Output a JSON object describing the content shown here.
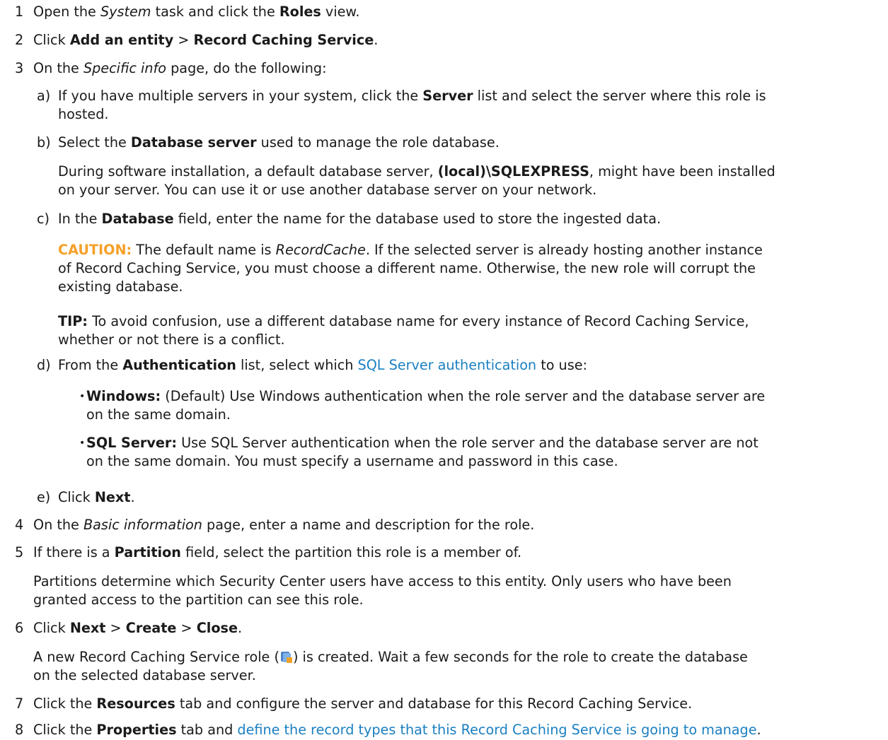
{
  "steps": [
    {
      "num": "1",
      "t1": "Open the ",
      "i1": "System",
      "t2": " task and click the ",
      "b1": "Roles",
      "t3": " view."
    },
    {
      "num": "2",
      "t1": "Click ",
      "b1": "Add an entity",
      "t2": " > ",
      "b2": "Record Caching Service",
      "t3": "."
    },
    {
      "num": "3",
      "t1": "On the ",
      "i1": "Specific info",
      "t2": " page, do the following:"
    },
    {
      "num": "4",
      "t1": "On the ",
      "i1": "Basic information",
      "t2": " page, enter a name and description for the role."
    },
    {
      "num": "5",
      "t1": "If there is a ",
      "b1": "Partition",
      "t2": " field, select the partition this role is a member of.",
      "p1": "Partitions determine which Security Center users have access to this entity. Only users who have been",
      "p2": "granted access to the partition can see this role."
    },
    {
      "num": "6",
      "t1": "Click ",
      "b1": "Next",
      "t2": " > ",
      "b2": "Create",
      "t3": " > ",
      "b3": "Close",
      "t4": ".",
      "p1a": "A new Record Caching Service role (",
      "p1b": ") is created. Wait a few seconds for the role to create the database",
      "p2": "on the selected database server."
    },
    {
      "num": "7",
      "t1": "Click the ",
      "b1": "Resources",
      "t2": " tab and configure the server and database for this Record Caching Service."
    },
    {
      "num": "8",
      "t1": "Click the ",
      "b1": "Properties",
      "t2": " tab and ",
      "link": "define the record types that this Record Caching Service is going to manage",
      "t3": "."
    }
  ],
  "substeps": {
    "a": {
      "letter": "a)",
      "t1": "If you have multiple servers in your system, click the ",
      "b1": "Server",
      "t2": " list and select the server where this role is",
      "l2": "hosted."
    },
    "b": {
      "letter": "b)",
      "t1": "Select the ",
      "b1": "Database server",
      "t2": " used to manage the role database.",
      "p1a": "During software installation, a default database server, ",
      "p1b": "(local)\\SQLEXPRESS",
      "p1c": ", might have been installed",
      "p2": "on your server. You can use it or use another database server on your network."
    },
    "c": {
      "letter": "c)",
      "t1": "In the ",
      "b1": "Database",
      "t2": " field, enter the name for the database used to store the ingested data.",
      "caution_label": "CAUTION:",
      "c1a": "  The default name is ",
      "c1b": "RecordCache",
      "c1c": ". If the selected server is already hosting another instance",
      "c2": "of Record Caching Service, you must choose a different name. Otherwise, the new role will corrupt the",
      "c3": "existing database.",
      "tip_label": "TIP:",
      "tip1": "  To avoid confusion, use a different database name for every instance of Record Caching Service,",
      "tip2": "whether or not there is a conflict."
    },
    "d": {
      "letter": "d)",
      "t1": "From the ",
      "b1": "Authentication",
      "t2": " list, select which ",
      "link": "SQL Server authentication",
      "t3": " to use:",
      "bullets": [
        {
          "label": "Windows:",
          "l1": " (Default) Use Windows authentication when the role server and the database server are",
          "l2": "on the same domain."
        },
        {
          "label": "SQL Server:",
          "l1": " Use SQL Server authentication when the role server and the database server are not",
          "l2": "on the same domain. You must specify a username and password in this case."
        }
      ]
    },
    "e": {
      "letter": "e)",
      "t1": "Click ",
      "b1": "Next",
      "t2": "."
    }
  }
}
